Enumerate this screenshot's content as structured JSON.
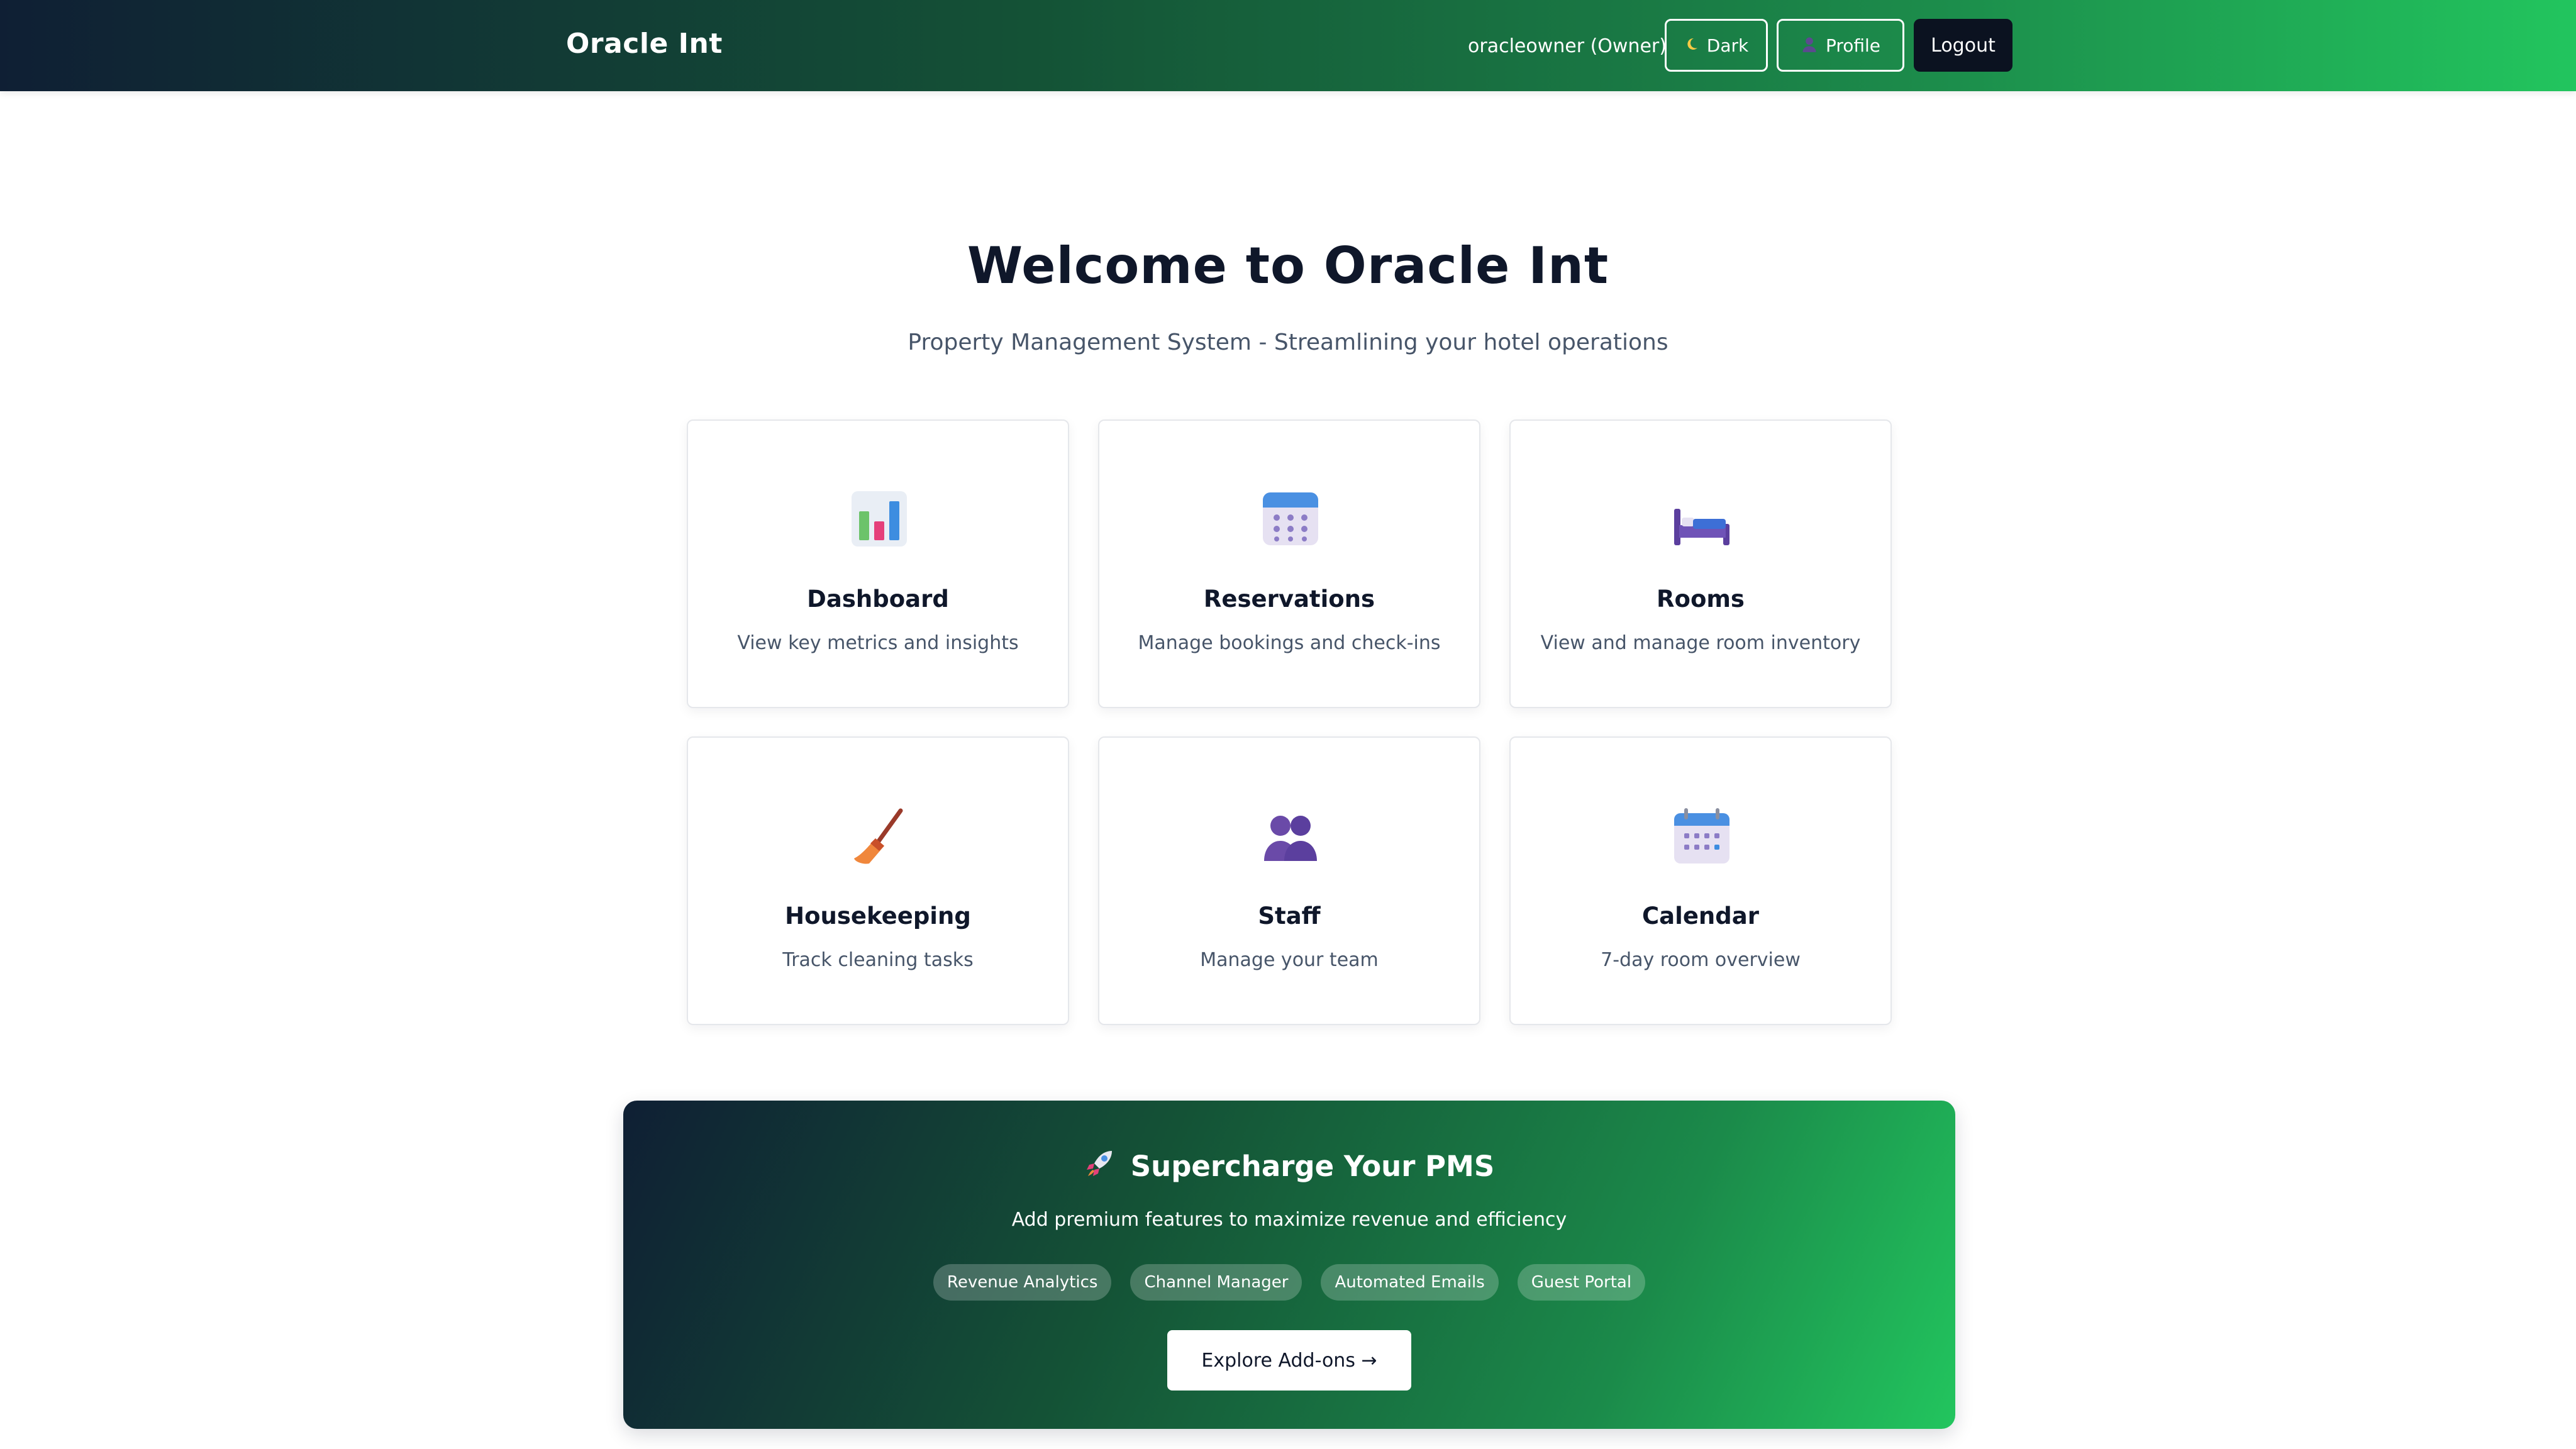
{
  "header": {
    "brand": "Oracle Int",
    "user": "oracleowner (Owner)",
    "dark_label": "Dark",
    "profile_label": "Profile",
    "logout_label": "Logout"
  },
  "hero": {
    "title": "Welcome to Oracle Int",
    "subtitle": "Property Management System - Streamlining your hotel operations"
  },
  "cards": [
    {
      "title": "Dashboard",
      "desc": "View key metrics and insights",
      "icon": "bar-chart-icon"
    },
    {
      "title": "Reservations",
      "desc": "Manage bookings and check-ins",
      "icon": "calendar-grid-icon"
    },
    {
      "title": "Rooms",
      "desc": "View and manage room inventory",
      "icon": "bed-icon"
    },
    {
      "title": "Housekeeping",
      "desc": "Track cleaning tasks",
      "icon": "broom-icon"
    },
    {
      "title": "Staff",
      "desc": "Manage your team",
      "icon": "people-icon"
    },
    {
      "title": "Calendar",
      "desc": "7-day room overview",
      "icon": "spiral-calendar-icon"
    }
  ],
  "promo": {
    "title": "Supercharge Your PMS",
    "subtitle": "Add premium features to maximize revenue and efficiency",
    "chips": [
      "Revenue Analytics",
      "Channel Manager",
      "Automated Emails",
      "Guest Portal"
    ],
    "cta": "Explore Add-ons →"
  },
  "colors": {
    "header_gradient_start": "#0f1f34",
    "header_gradient_end": "#22c55e",
    "text_dark": "#0f172a",
    "text_muted": "#475569"
  }
}
